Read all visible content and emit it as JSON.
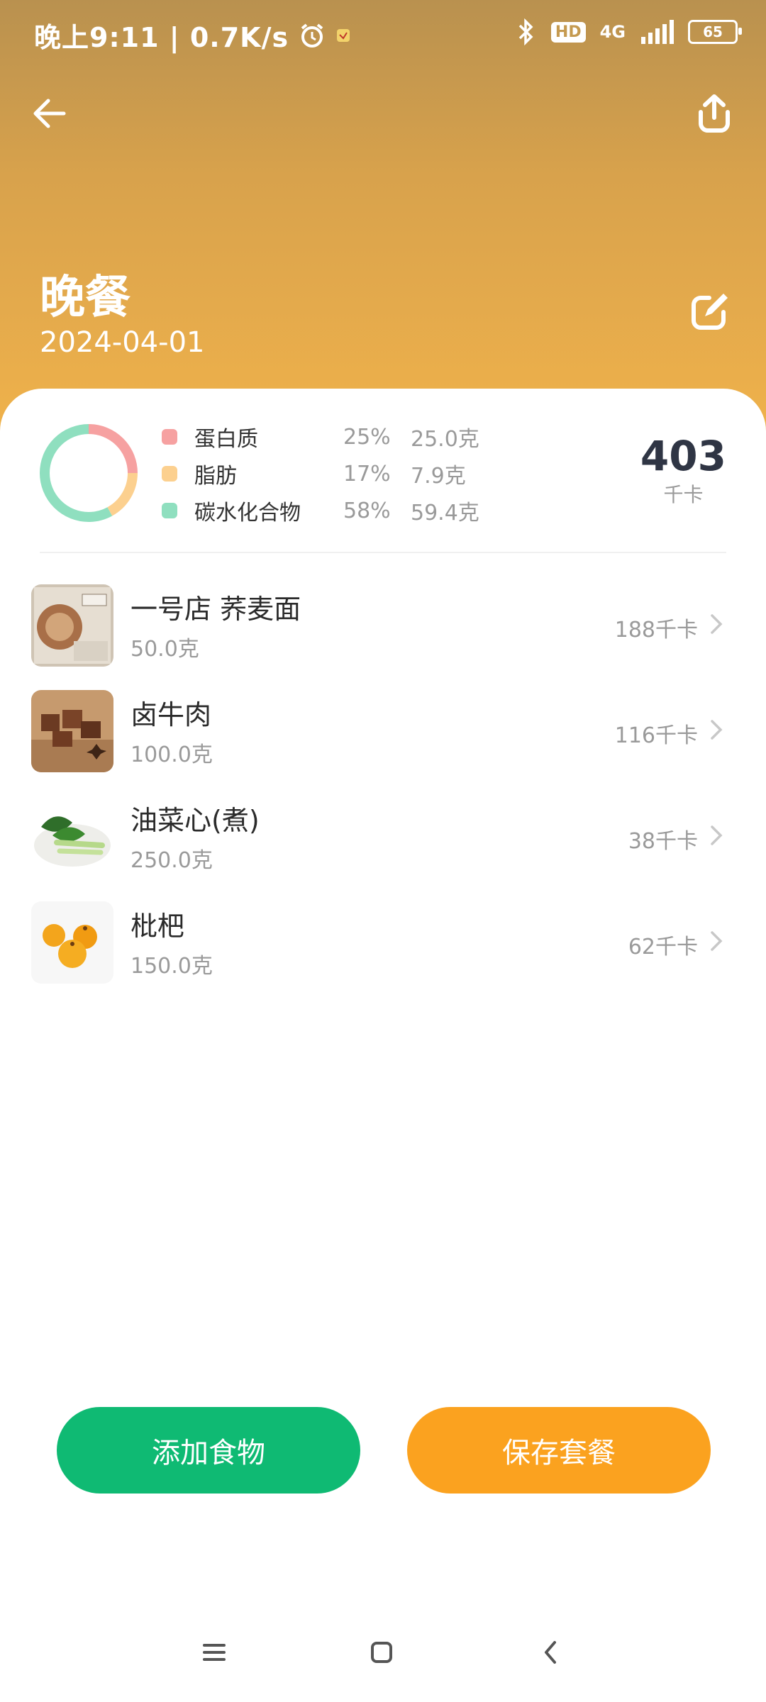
{
  "status_bar": {
    "time_speed": "晚上9:11 | 0.7K/s",
    "hd": "HD",
    "network": "4G",
    "battery": "65"
  },
  "header": {
    "title": "晚餐",
    "date": "2024-04-01"
  },
  "nutrition": {
    "items": [
      {
        "name": "蛋白质",
        "percent": "25%",
        "grams": "25.0克",
        "color": "#f6a1a1",
        "fraction": 0.25
      },
      {
        "name": "脂肪",
        "percent": "17%",
        "grams": "7.9克",
        "color": "#fcd08f",
        "fraction": 0.17
      },
      {
        "name": "碳水化合物",
        "percent": "58%",
        "grams": "59.4克",
        "color": "#8fdfbf",
        "fraction": 0.58
      }
    ],
    "total_value": "403",
    "total_unit": "千卡"
  },
  "foods": [
    {
      "name": "一号店 荞麦面",
      "quantity": "50.0克",
      "kcal": "188千卡",
      "image": "noodle-package-photo"
    },
    {
      "name": "卤牛肉",
      "quantity": "100.0克",
      "kcal": "116千卡",
      "image": "braised-beef-photo"
    },
    {
      "name": "油菜心(煮)",
      "quantity": "250.0克",
      "kcal": "38千卡",
      "image": "bok-choy-photo"
    },
    {
      "name": "枇杷",
      "quantity": "150.0克",
      "kcal": "62千卡",
      "image": "loquat-photo"
    }
  ],
  "actions": {
    "add_food": "添加食物",
    "save_combo": "保存套餐"
  },
  "colors": {
    "accent_green": "#0fba73",
    "accent_orange": "#fba21f",
    "header_top": "#b9914f",
    "header_bottom": "#f0b24b"
  }
}
